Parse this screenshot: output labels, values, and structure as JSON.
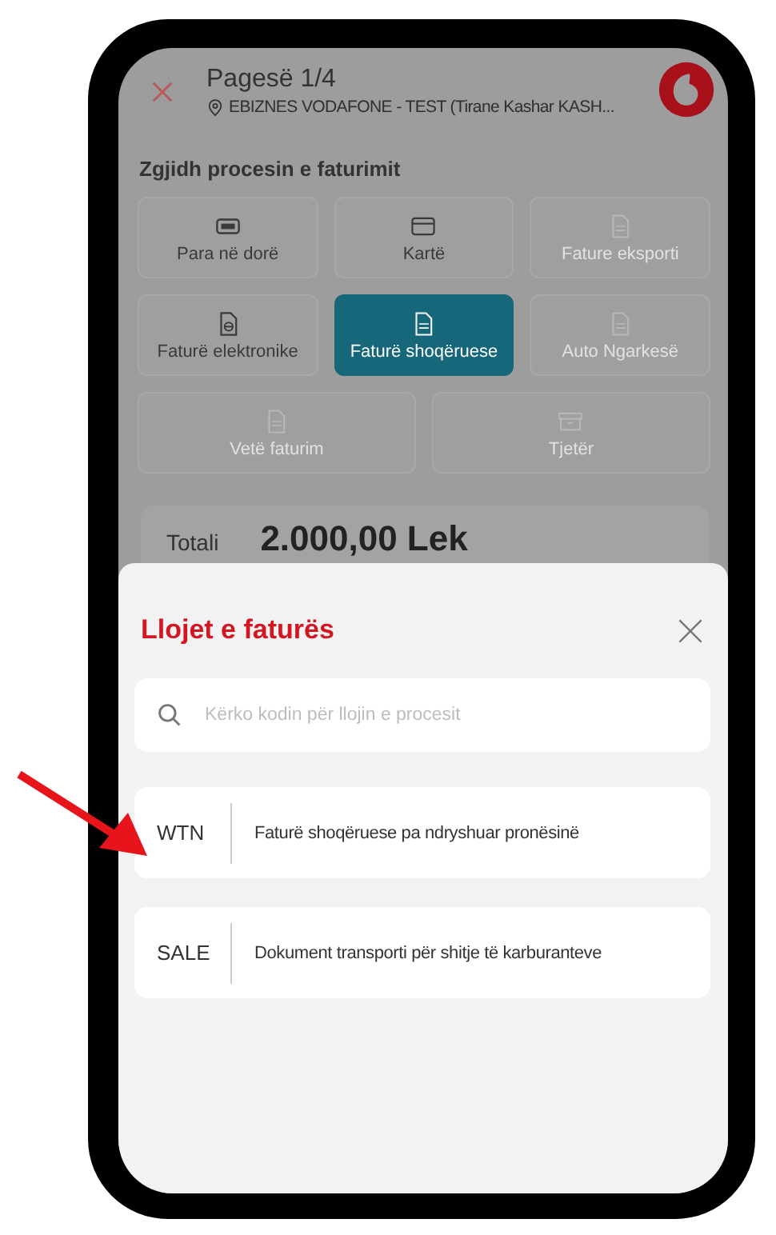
{
  "header": {
    "title": "Pagesë 1/4",
    "location": "EBIZNES VODAFONE - TEST (Tirane Kashar KASH..."
  },
  "process": {
    "heading": "Zgjidh procesin e faturimit",
    "options": [
      {
        "label": "Para në dorë",
        "kind": "cash",
        "selected": false,
        "disabled": false
      },
      {
        "label": "Kartë",
        "kind": "card",
        "selected": false,
        "disabled": false
      },
      {
        "label": "Fature eksporti",
        "kind": "document",
        "selected": false,
        "disabled": true
      },
      {
        "label": "Faturë elektronike",
        "kind": "e-document",
        "selected": false,
        "disabled": false
      },
      {
        "label": "Faturë shoqëruese",
        "kind": "document",
        "selected": true,
        "disabled": false
      },
      {
        "label": "Auto Ngarkesë",
        "kind": "document",
        "selected": false,
        "disabled": true
      },
      {
        "label": "Vetë faturim",
        "kind": "document",
        "selected": false,
        "disabled": true
      },
      {
        "label": "Tjetër",
        "kind": "box",
        "selected": false,
        "disabled": true
      }
    ]
  },
  "total": {
    "label": "Totali",
    "amount": "2.000,00 Lek"
  },
  "sheet": {
    "title": "Llojet e faturës",
    "search": {
      "placeholder": "Kërko kodin për llojin e procesit"
    },
    "items": [
      {
        "code": "WTN",
        "description": "Faturë shoqëruese pa ndryshuar pronësinë"
      },
      {
        "code": "SALE",
        "description": "Dokument transporti për shitje të karburanteve"
      }
    ]
  }
}
